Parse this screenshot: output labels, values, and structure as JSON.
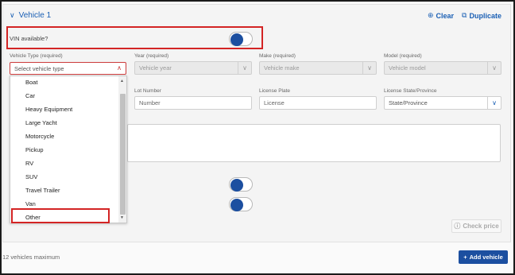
{
  "vehicle": {
    "title": "Vehicle 1",
    "clear_label": "Clear",
    "duplicate_label": "Duplicate"
  },
  "vin": {
    "label": "VIN available?"
  },
  "fields": {
    "vehicle_type_label": "Vehicle Type (required)",
    "vehicle_type_placeholder": "Select vehicle type",
    "year_label": "Year (required)",
    "year_placeholder": "Vehicle year",
    "make_label": "Make (required)",
    "make_placeholder": "Vehicle make",
    "model_label": "Model (required)",
    "model_placeholder": "Vehicle model",
    "lot_label": "Lot Number",
    "lot_placeholder": "Number",
    "plate_label": "License Plate",
    "plate_placeholder": "License",
    "state_label": "License State/Province",
    "state_placeholder": "State/Province"
  },
  "dropdown": {
    "options": [
      "Boat",
      "Car",
      "Heavy Equipment",
      "Large Yacht",
      "Motorcycle",
      "Pickup",
      "RV",
      "SUV",
      "Travel Trailer",
      "Van",
      "Other"
    ],
    "highlighted": "Other"
  },
  "footer": {
    "check_price_label": "Check price",
    "max_note": "12 vehicles maximum",
    "add_vehicle_label": "Add vehicle"
  },
  "colors": {
    "accent": "#1c4fa0",
    "highlight_box": "#d32424"
  }
}
